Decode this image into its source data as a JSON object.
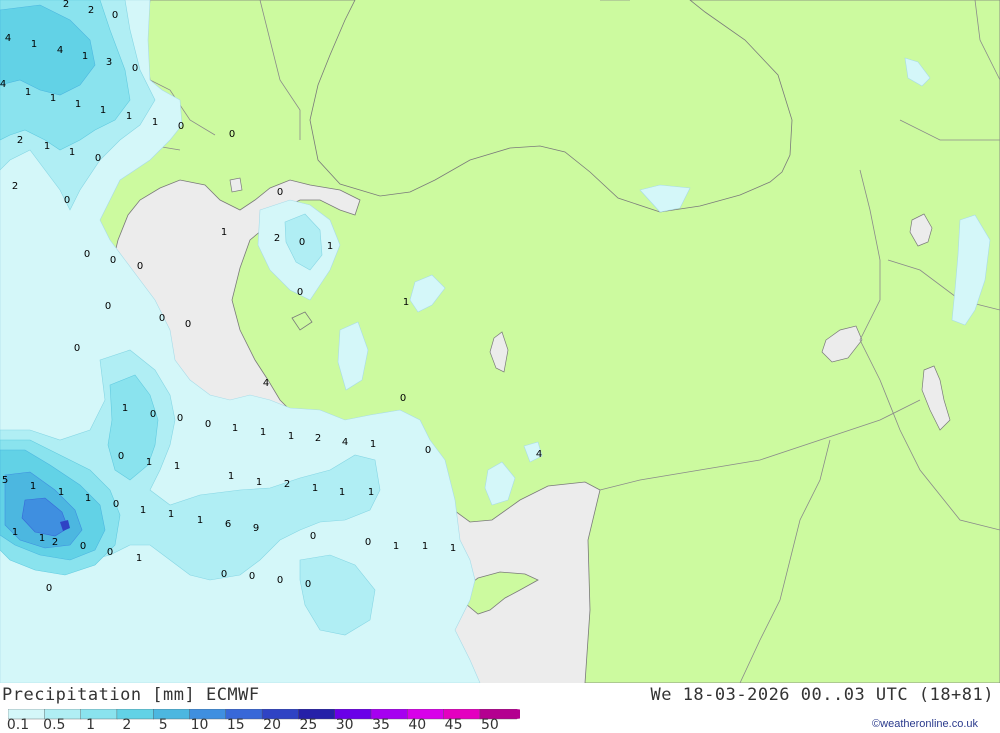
{
  "map": {
    "colors": {
      "sea": "#ececec",
      "land": "#ccfa9f",
      "border": "#8a8a8a",
      "coast": "#7a7a7a"
    },
    "values": [
      "2",
      "2",
      "0",
      "4",
      "1",
      "4",
      "1",
      "3",
      "0",
      "4",
      "1",
      "1",
      "1",
      "1",
      "1",
      "1",
      "0",
      "0",
      "2",
      "1",
      "1",
      "0",
      "2",
      "0",
      "0",
      "1",
      "2",
      "0",
      "1",
      "0",
      "0",
      "0",
      "0",
      "1",
      "0",
      "0",
      "0",
      "0",
      "4",
      "0",
      "1",
      "0",
      "0",
      "0",
      "1",
      "1",
      "1",
      "2",
      "4",
      "1",
      "0",
      "0",
      "1",
      "1",
      "4",
      "5",
      "1",
      "1",
      "1",
      "0",
      "1",
      "1",
      "2",
      "1",
      "1",
      "1",
      "1",
      "1",
      "1",
      "6",
      "9",
      "1",
      "1",
      "2",
      "0",
      "0",
      "1",
      "0",
      "0",
      "1",
      "1",
      "1",
      "0",
      "0",
      "0",
      "0",
      "0"
    ]
  },
  "legend": {
    "title": "Precipitation [mm] ECMWF",
    "validity": "We 18-03-2026 00..03 UTC (18+81)",
    "credit": "©weatheronline.co.uk",
    "ticks": [
      "0.1",
      "0.5",
      "1",
      "2",
      "5",
      "10",
      "15",
      "20",
      "25",
      "30",
      "35",
      "40",
      "45",
      "50"
    ],
    "colors": [
      "#d4f7f9",
      "#b0eef4",
      "#8ae3ee",
      "#62d2e6",
      "#4cb7e0",
      "#3f8fe0",
      "#3868d8",
      "#2f43c4",
      "#2520a8",
      "#6a00e8",
      "#a600f0",
      "#d800ea",
      "#e400c0",
      "#b40090"
    ]
  }
}
